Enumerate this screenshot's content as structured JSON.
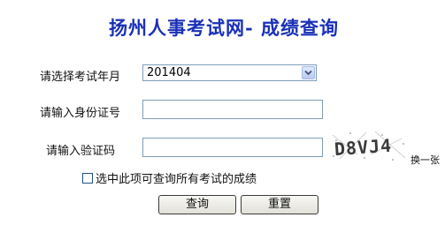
{
  "header": {
    "title": "扬州人事考试网- 成绩查询"
  },
  "form": {
    "exam_month_label": "请选择考试年月",
    "exam_month_value": "201404",
    "id_number_label": "请输入身份证号",
    "id_number_value": "",
    "captcha_label": "请输入验证码",
    "captcha_value": "",
    "captcha_text": "D8VJ4",
    "refresh_captcha": "换一张",
    "query_all_label": "选中此项可查询所有考试的成绩",
    "query_all_checked": false
  },
  "buttons": {
    "query": "查询",
    "reset": "重置"
  }
}
